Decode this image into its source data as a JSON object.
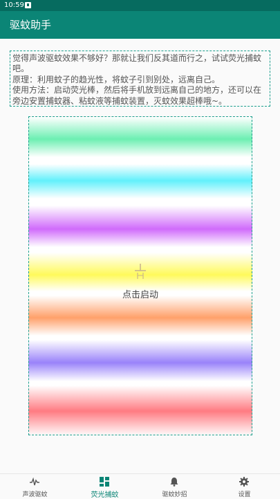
{
  "status_bar": {
    "time": "10:59"
  },
  "app_bar": {
    "title": "驱蚊助手"
  },
  "intro": {
    "line1": "觉得声波驱蚊效果不够好？那就让我们反其道而行之，试试荧光捕蚊吧。",
    "line2": "原理：利用蚊子的趋光性，将蚊子引到别处，远离自己。",
    "line3": "使用方法：启动荧光棒，然后将手机放到远离自己的地方，还可以在旁边安置捕蚊器、粘蚊液等捕蚊装置，灭蚊效果超棒哦~。"
  },
  "panel": {
    "label": "点击启动",
    "stripe_colors": [
      "#6cefb2",
      "#62f0fb",
      "#d06bfb",
      "#fffa5b",
      "#ffa06a",
      "#9982fa",
      "#ff7b82"
    ]
  },
  "bottom_nav": {
    "items": [
      {
        "label": "声波驱蚊",
        "icon": "sound-wave-icon",
        "active": false
      },
      {
        "label": "荧光捕蚊",
        "icon": "dashboard-grid-icon",
        "active": true
      },
      {
        "label": "驱蚊妙招",
        "icon": "bell-icon",
        "active": false
      },
      {
        "label": "设置",
        "icon": "gear-icon",
        "active": false
      }
    ],
    "active_color": "#0b8576"
  },
  "colors": {
    "status_bar": "#066b5f",
    "app_bar": "#0b8576",
    "border": "#1a9e8c"
  }
}
